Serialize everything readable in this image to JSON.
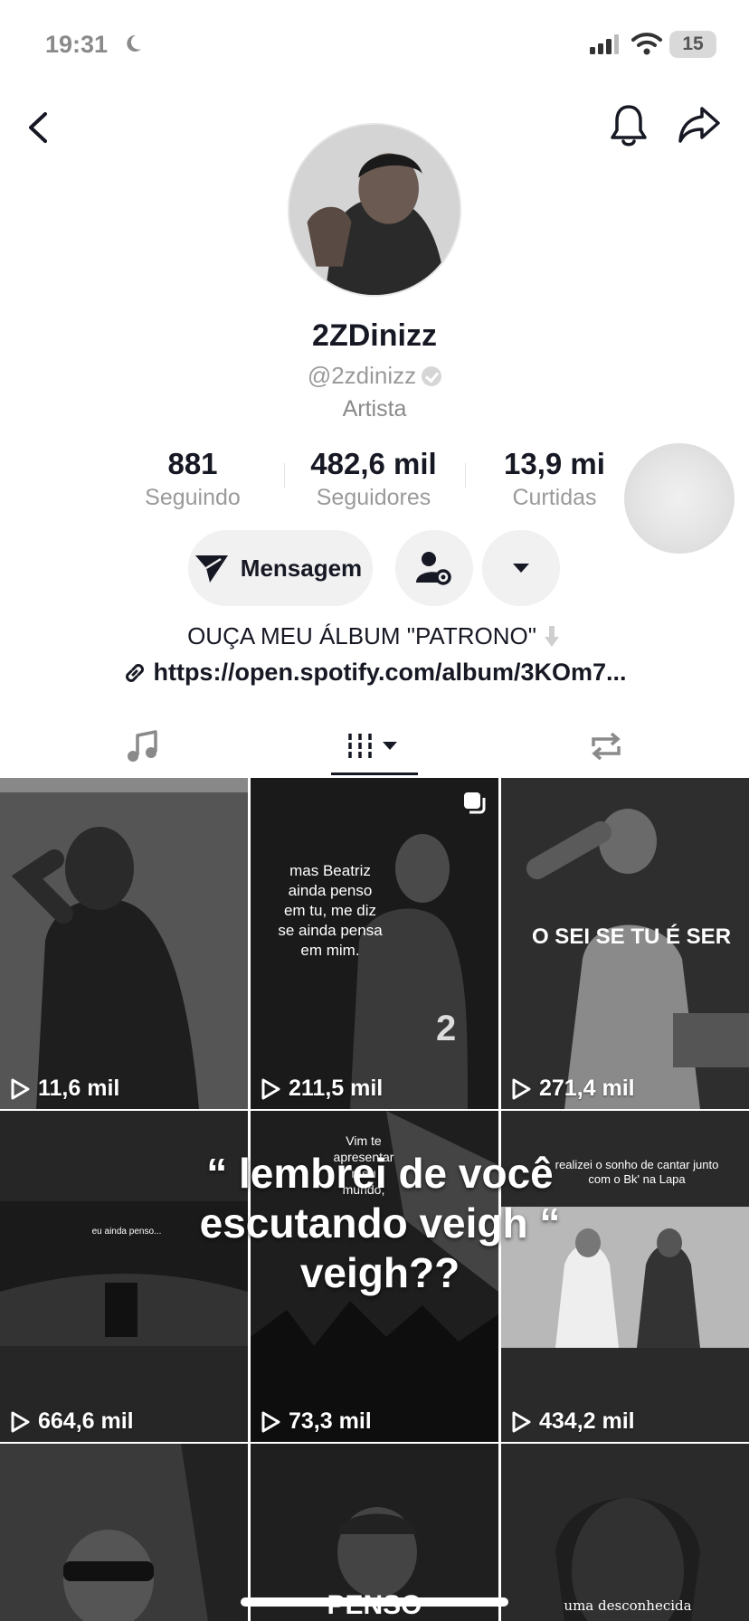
{
  "status_bar": {
    "time": "19:31",
    "battery": "15"
  },
  "profile": {
    "display_name": "2ZDinizz",
    "handle": "@2zdinizz",
    "category": "Artista"
  },
  "stats": [
    {
      "value": "881",
      "label": "Seguindo"
    },
    {
      "value": "482,6 mil",
      "label": "Seguidores"
    },
    {
      "value": "13,9 mi",
      "label": "Curtidas"
    }
  ],
  "buttons": {
    "message_label": "Mensagem"
  },
  "bio": {
    "text": "OUÇA MEU ÁLBUM \"PATRONO\"",
    "link": "https://open.spotify.com/album/3KOm7..."
  },
  "videos": [
    {
      "views": "11,6 mil",
      "caption": ""
    },
    {
      "views": "211,5 mil",
      "caption": "mas Beatriz ainda penso em tu, me diz se ainda pensa em mim."
    },
    {
      "views": "271,4 mil",
      "caption": "O SEI SE TU É SER"
    },
    {
      "views": "664,6 mil",
      "caption": "eu ainda penso..."
    },
    {
      "views": "73,3 mil",
      "caption": "Vim te apresentar meu mundo,"
    },
    {
      "views": "434,2 mil",
      "caption": "realizei o sonho de cantar junto com o Bk' na Lapa"
    },
    {
      "views": "",
      "caption": ""
    },
    {
      "views": "",
      "caption": "PENSO"
    },
    {
      "views": "",
      "caption": "uma desconhecida"
    }
  ],
  "overlay_caption": "“ lembrei de você escutando veigh “ veigh??",
  "icons": {
    "back": "chevron-left-icon",
    "bell": "bell-icon",
    "share": "share-icon",
    "message": "paper-plane-icon",
    "person": "person-settings-icon",
    "dropdown": "caret-down-icon",
    "tab_music": "music-note-icon",
    "tab_videos": "grid-icon",
    "tab_reposts": "repost-icon"
  },
  "colors": {
    "text": "#161823",
    "muted": "#9a9a9a",
    "button_bg": "#f1f1f2"
  }
}
